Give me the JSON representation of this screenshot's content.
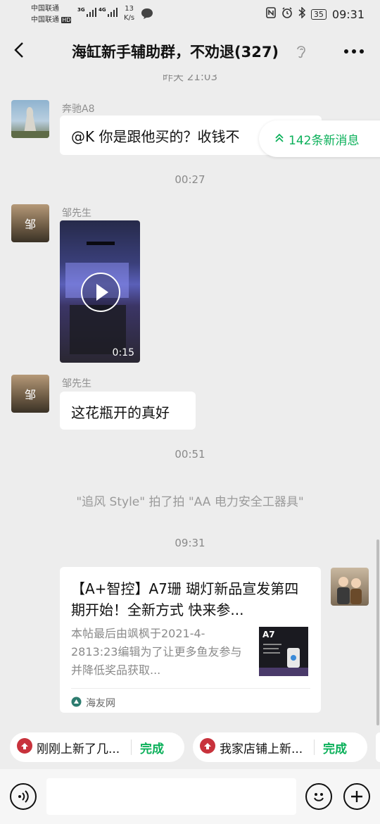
{
  "status_bar": {
    "carrier1": "中国联通",
    "carrier2": "中国联通",
    "hd_badge": "HD",
    "sig1_tag": "3G",
    "sig2_tag": "4G",
    "net_speed_value": "13",
    "net_speed_unit": "K/s",
    "battery": "35",
    "time": "09:31"
  },
  "header": {
    "title": "海缸新手辅助群，不劝退(327)"
  },
  "chat": {
    "partial_timestamp": "昨天 21:03",
    "msg1": {
      "sender": "奔驰A8",
      "text": "@K  你是跟他买的？收钱不"
    },
    "timestamp2": "00:27",
    "msg2": {
      "sender": "邹先生",
      "avatar_char": "邹",
      "video_duration": "0:15"
    },
    "msg3": {
      "sender": "邹先生",
      "avatar_char": "邹",
      "text": "这花瓶开的真好"
    },
    "timestamp3": "00:51",
    "system_msg": "\"追风 Style\" 拍了拍 \"AA 电力安全工器具\"",
    "timestamp4": "09:31",
    "card": {
      "title": "【A+智控】A7珊 瑚灯新品宣发第四期开始！全新方式  快来参...",
      "desc": "本帖最后由飒枫于2021-4-2813:23编辑为了让更多鱼友参与并降低奖品获取...",
      "thumb_label": "A7",
      "source": "海友网"
    }
  },
  "new_messages": {
    "label": "142条新消息"
  },
  "quick_bar": [
    {
      "text": "刚刚上新了几...",
      "action": "完成"
    },
    {
      "text": "我家店铺上新...",
      "action": "完成"
    }
  ],
  "colors": {
    "accent_green": "#0bb05a",
    "background": "#ededed",
    "bubble": "#ffffff",
    "chip_icon_red": "#c8323c"
  }
}
